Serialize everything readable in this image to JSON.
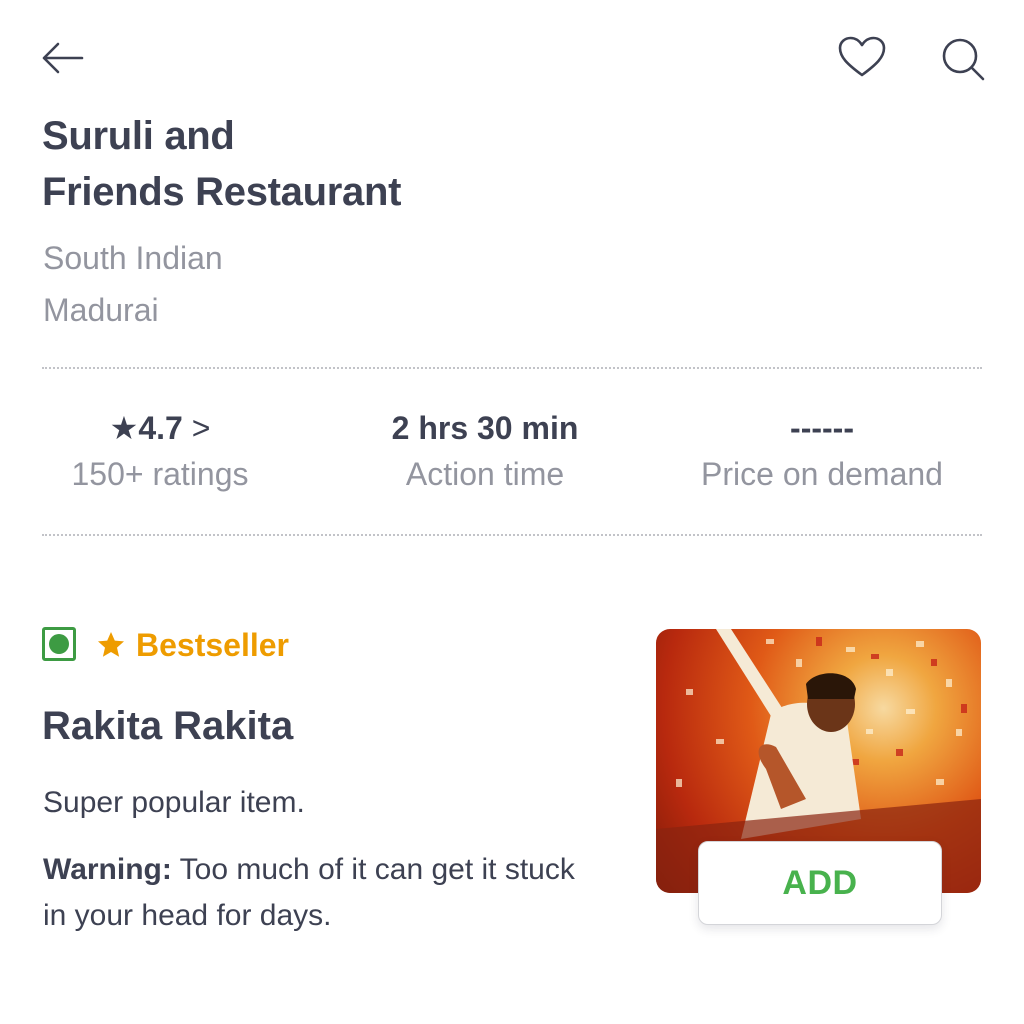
{
  "header": {
    "back_icon": "arrow-left-icon",
    "favorite_icon": "heart-outline-icon",
    "search_icon": "search-icon"
  },
  "restaurant": {
    "name_line1": "Suruli and",
    "name_line2": "Friends Restaurant",
    "cuisine": "South Indian",
    "location": "Madurai"
  },
  "stats": {
    "rating": {
      "star_icon": "star-icon",
      "value": "4.7",
      "chevron": ">",
      "label": "150+ ratings"
    },
    "time": {
      "value": "2 hrs 30 min",
      "label": "Action time"
    },
    "price": {
      "value": "------",
      "label": "Price on demand"
    }
  },
  "item": {
    "veg_icon": "veg-indicator-icon",
    "badge_icon": "star-icon",
    "badge": "Bestseller",
    "name": "Rakita Rakita",
    "description": "Super popular item.",
    "warning_label": "Warning:",
    "warning_text": "Too much of it can get it stuck in your head for days.",
    "add_label": "ADD"
  },
  "colors": {
    "text_primary": "#3d4152",
    "text_secondary": "#93959f",
    "veg_green": "#3d9b43",
    "bestseller_orange": "#ee9c00",
    "add_green": "#48b24d"
  }
}
